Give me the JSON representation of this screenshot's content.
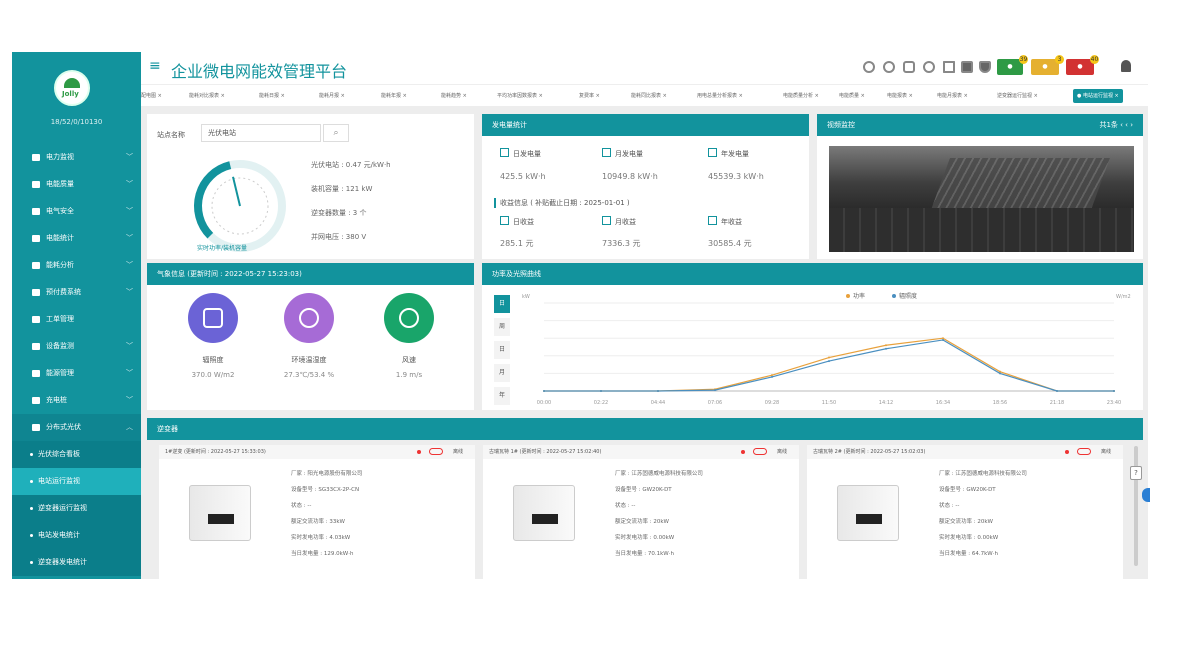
{
  "header": {
    "title": "企业微电网能效管理平台",
    "badges": [
      "39",
      "3",
      "40"
    ]
  },
  "sidebar": {
    "logo_text": "Jolly",
    "user": "18/52/0/10130",
    "items": [
      {
        "label": "电力监视",
        "arrow": "﹀"
      },
      {
        "label": "电能质量",
        "arrow": "﹀"
      },
      {
        "label": "电气安全",
        "arrow": "﹀"
      },
      {
        "label": "电能统计",
        "arrow": "﹀"
      },
      {
        "label": "能耗分析",
        "arrow": "﹀"
      },
      {
        "label": "预付费系统",
        "arrow": "﹀"
      },
      {
        "label": "工单管理",
        "arrow": ""
      },
      {
        "label": "设备监测",
        "arrow": "﹀"
      },
      {
        "label": "能源管理",
        "arrow": "﹀"
      },
      {
        "label": "充电桩",
        "arrow": "﹀"
      },
      {
        "label": "分布式光伏",
        "arrow": "︿"
      }
    ],
    "subitems": [
      "光伏综合看板",
      "电站运行监视",
      "逆变器运行监视",
      "电站发电统计",
      "逆变器发电统计"
    ]
  },
  "tabs": [
    "配电图 ×",
    "能耗对比报表 ×",
    "能耗日报 ×",
    "能耗月报 ×",
    "能耗年报 ×",
    "能耗趋势 ×",
    "平均功率因数报表 ×",
    "复费率 ×",
    "能耗同比报表 ×",
    "用电总量分析报表 ×",
    "电能质量分析 ×",
    "电能质量 ×",
    "电能报表 ×",
    "电能月报表 ×",
    "逆变器运行监视 ×",
    "● 电站运行监视 ×"
  ],
  "site": {
    "label": "站点名称",
    "input_value": "光伏电站",
    "search_icon": "⌕",
    "gauge_caption": "实时功率/装机容量",
    "gauge_value": 0.45,
    "kv": [
      "光伏电站 : 0.47 元/kW·h",
      "装机容量 : 121 kW",
      "逆变器数量 : 3 个",
      "并网电压 : 380 V"
    ]
  },
  "generation": {
    "title": "发电量统计",
    "stats": [
      {
        "label": "日发电量",
        "value": "425.5 kW·h"
      },
      {
        "label": "月发电量",
        "value": "10949.8 kW·h"
      },
      {
        "label": "年发电量",
        "value": "45539.3 kW·h"
      }
    ],
    "income_title": "收益信息 ( 补贴截止日期 : 2025-01-01 )",
    "income": [
      {
        "label": "日收益",
        "value": "285.1 元"
      },
      {
        "label": "月收益",
        "value": "7336.3 元"
      },
      {
        "label": "年收益",
        "value": "30585.4 元"
      }
    ]
  },
  "monitor": {
    "title": "视频监控",
    "pager": "共1条  ‹  ‹  ›"
  },
  "weather": {
    "title": "气象信息 (更新时间 : 2022-05-27 15:23:03)",
    "items": [
      {
        "name": "辐照度",
        "value": "370.0 W/m2",
        "color": "#6b63d6"
      },
      {
        "name": "环境温湿度",
        "value": "27.3℃/53.4 %",
        "color": "#a66bd6"
      },
      {
        "name": "风速",
        "value": "1.9 m/s",
        "color": "#19a56a"
      }
    ]
  },
  "power_chart": {
    "title": "功率及光照曲线",
    "vtabs": [
      "日",
      "周",
      "日",
      "月",
      "年"
    ],
    "legend": [
      "功率",
      "辐照度"
    ]
  },
  "chart_data": {
    "type": "line",
    "title": "",
    "xlabel": "",
    "ylabel": "kW",
    "ylabel_right": "W/m2",
    "x": [
      "00:00",
      "02:22",
      "04:44",
      "07:06",
      "09:28",
      "11:50",
      "14:12",
      "16:34",
      "18:56",
      "21:18",
      "23:40"
    ],
    "series": [
      {
        "name": "功率",
        "color": "#e8a13c",
        "values": [
          0,
          0,
          0,
          2,
          18,
          38,
          52,
          60,
          22,
          0,
          0
        ]
      },
      {
        "name": "辐照度",
        "color": "#4a8fc0",
        "values": [
          0,
          0,
          0,
          1,
          16,
          34,
          48,
          58,
          20,
          0,
          0
        ]
      }
    ],
    "ylim": [
      0,
      100
    ],
    "grid": true,
    "legend_placement": "top-center"
  },
  "inverters": {
    "title": "逆变器",
    "cards": [
      {
        "title": "1#逆变 (更新时间 : 2022-05-27 15:33:03)",
        "status_label": "离线",
        "kv": [
          "厂家 : 阳光电源股份有限公司",
          "设备型号 : SG33CX-2P-CN",
          "状态 : --",
          "额定交流功率 : 33kW",
          "实时发电功率 : 4.03kW",
          "当日发电量 : 129.0kW·h"
        ]
      },
      {
        "title": "古瑞瓦特 1# (更新时间 : 2022-05-27 15:02:40)",
        "status_label": "离线",
        "kv": [
          "厂家 : 江苏固德威电源科技有限公司",
          "设备型号 : GW20K-DT",
          "状态 : --",
          "额定交流功率 : 20kW",
          "实时发电功率 : 0.00kW",
          "当日发电量 : 70.1kW·h"
        ]
      },
      {
        "title": "古瑞瓦特 2# (更新时间 : 2022-05-27 15:02:03)",
        "status_label": "离线",
        "kv": [
          "厂家 : 江苏固德威电源科技有限公司",
          "设备型号 : GW20K-DT",
          "状态 : --",
          "额定交流功率 : 20kW",
          "实时发电功率 : 0.00kW",
          "当日发电量 : 64.7kW·h"
        ]
      }
    ]
  },
  "float_button": "?"
}
